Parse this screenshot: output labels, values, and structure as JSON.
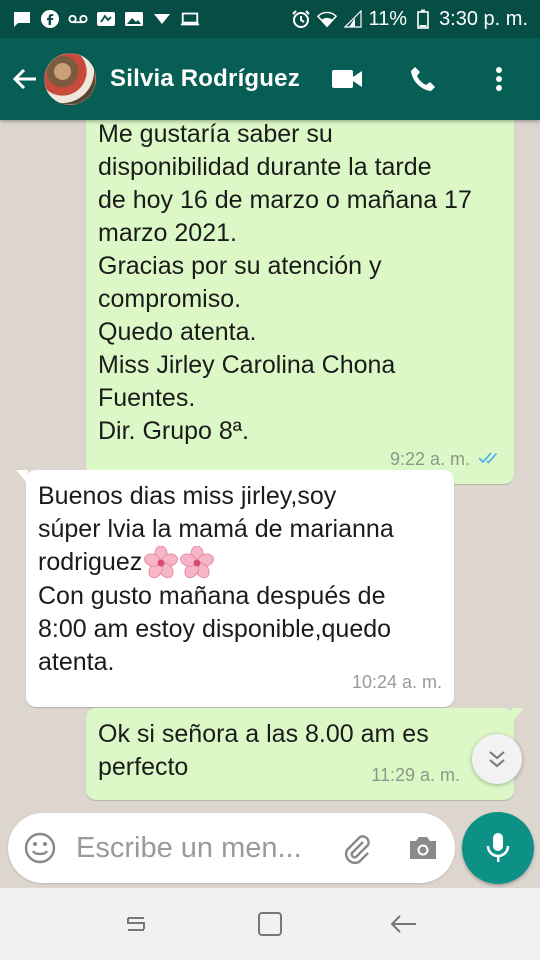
{
  "status_bar": {
    "battery": "11%",
    "time": "3:30 p. m."
  },
  "header": {
    "contact_name": "Silvia Rodríguez"
  },
  "messages": [
    {
      "direction": "out",
      "text": "Me gustaría saber su\ndisponibilidad durante la tarde\nde hoy 16 de marzo o mañana 17\nmarzo 2021.\nGracias por su atención y\ncompromiso.\nQuedo atenta.\nMiss Jirley Carolina Chona\nFuentes.\nDir. Grupo 8ª.",
      "time": "9:22 a. m.",
      "status": "read"
    },
    {
      "direction": "in",
      "text_before_emoji": "Buenos dias miss jirley,soy\nsúper lvia la mamá de marianna\nrodriguez",
      "emoji": "🌸🌸",
      "text_after_emoji": "\nCon gusto mañana después de\n8:00 am estoy disponible,quedo\natenta.",
      "time": "10:24 a. m."
    },
    {
      "direction": "out",
      "text": "Ok si señora a las 8.00 am es\nperfecto",
      "time": "11:29 a. m."
    }
  ],
  "composer": {
    "placeholder": "Escribe un men..."
  },
  "colors": {
    "header": "#075e54",
    "status_bar": "#064e45",
    "outgoing_bubble": "#dcf8c6",
    "incoming_bubble": "#ffffff",
    "chat_background": "#ddd6cf",
    "mic_button": "#0d9085",
    "read_ticks": "#4fb6ec"
  }
}
